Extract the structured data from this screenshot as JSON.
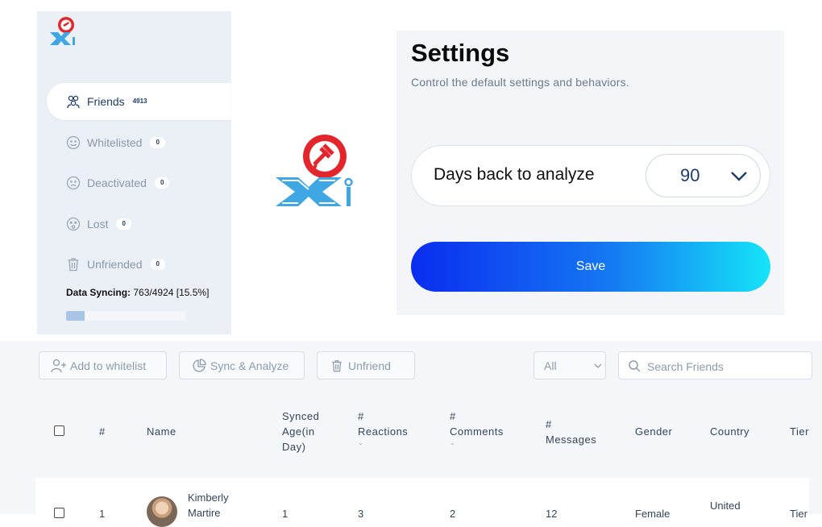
{
  "sidebar": {
    "items": [
      {
        "label": "Friends",
        "count": "4913",
        "icon": "friends-icon"
      },
      {
        "label": "Whitelisted",
        "count": "0",
        "icon": "smile-icon"
      },
      {
        "label": "Deactivated",
        "count": "0",
        "icon": "sad-icon"
      },
      {
        "label": "Lost",
        "count": "0",
        "icon": "dizzy-icon"
      },
      {
        "label": "Unfriended",
        "count": "0",
        "icon": "trash-icon"
      }
    ],
    "sync": {
      "label": "Data Syncing:",
      "value": "763/4924 [15.5%]",
      "progress": 0.155
    }
  },
  "settings": {
    "title": "Settings",
    "subtitle": "Control the default settings and behaviors.",
    "days_label": "Days back to analyze",
    "days_value": "90",
    "save_label": "Save"
  },
  "toolbar": {
    "add_whitelist": "Add to whitelist",
    "sync_analyze": "Sync & Analyze",
    "unfriend": "Unfriend",
    "filter_value": "All",
    "search_placeholder": "Search Friends"
  },
  "table": {
    "headers": {
      "num": "#",
      "name": "Name",
      "synced_age": [
        "Synced",
        "Age(in",
        "Day)"
      ],
      "reactions": [
        "#",
        "Reactions"
      ],
      "comments": [
        "#",
        "Comments"
      ],
      "messages": [
        "#",
        "Messages"
      ],
      "gender": "Gender",
      "country": "Country",
      "tier": "Tier"
    },
    "rows": [
      {
        "num": "1",
        "name": [
          "Kimberly",
          "Martire"
        ],
        "synced_age": "1",
        "reactions": "3",
        "comments": "2",
        "messages": "12",
        "gender": "Female",
        "country": "United",
        "tier": "Tier"
      }
    ]
  },
  "colors": {
    "accent": "#1e3d6b",
    "save_gradient_start": "#0a2df0",
    "save_gradient_end": "#15e4f8",
    "logo_red": "#e3262b",
    "logo_blue": "#3ea7e4"
  }
}
